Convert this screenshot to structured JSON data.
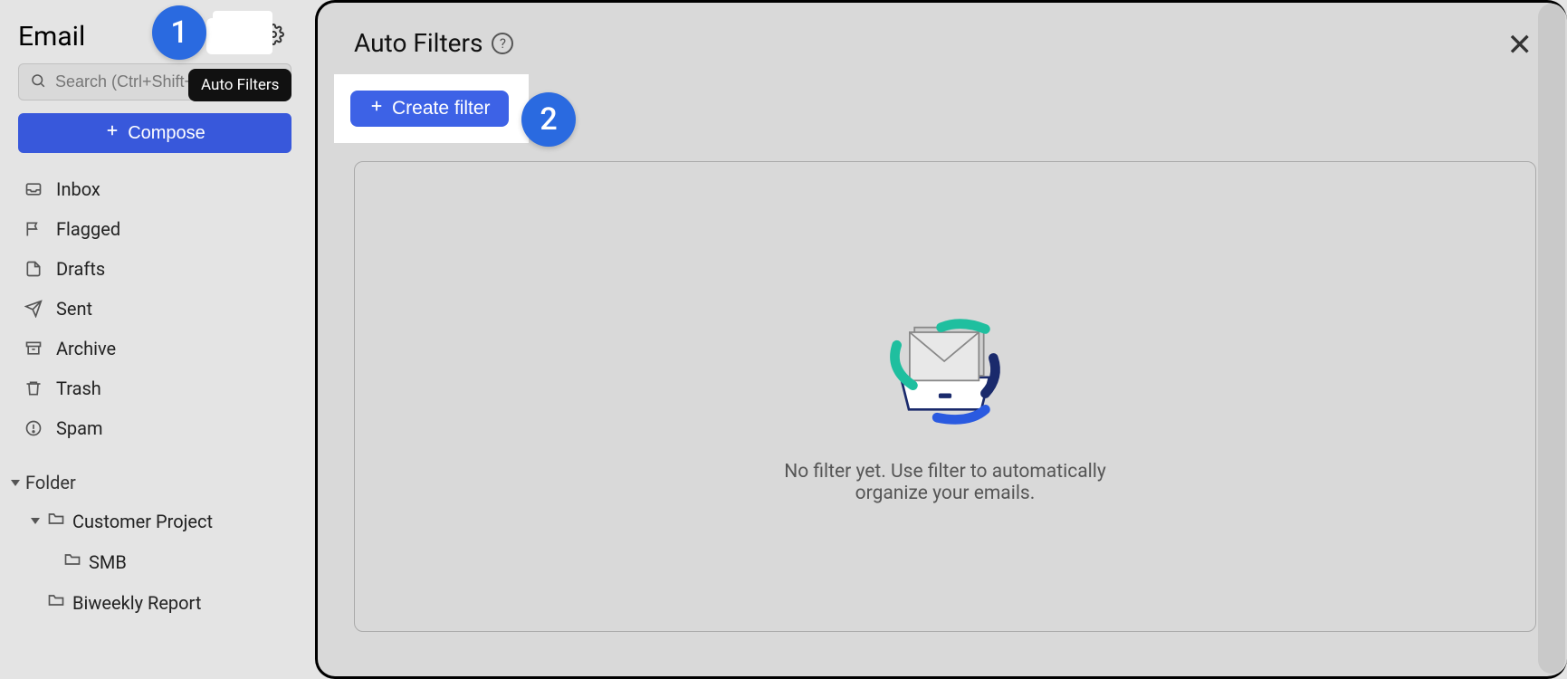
{
  "app": {
    "title": "Email"
  },
  "search": {
    "placeholder": "Search (Ctrl+Shift+F)"
  },
  "compose": {
    "label": " Compose"
  },
  "sidebar": {
    "items": [
      {
        "label": "Inbox"
      },
      {
        "label": "Flagged"
      },
      {
        "label": "Drafts"
      },
      {
        "label": "Sent"
      },
      {
        "label": "Archive"
      },
      {
        "label": "Trash"
      },
      {
        "label": "Spam"
      }
    ],
    "folder_header": "Folder",
    "folders": [
      {
        "label": "Customer Project"
      },
      {
        "label": "SMB"
      },
      {
        "label": "Biweekly Report"
      }
    ]
  },
  "tooltip": {
    "auto_filters": "Auto Filters"
  },
  "callouts": {
    "one": "1",
    "two": "2"
  },
  "panel": {
    "title": "Auto Filters",
    "create_label": "Create filter",
    "empty_text": "No filter yet. Use filter to automatically organize your emails."
  }
}
